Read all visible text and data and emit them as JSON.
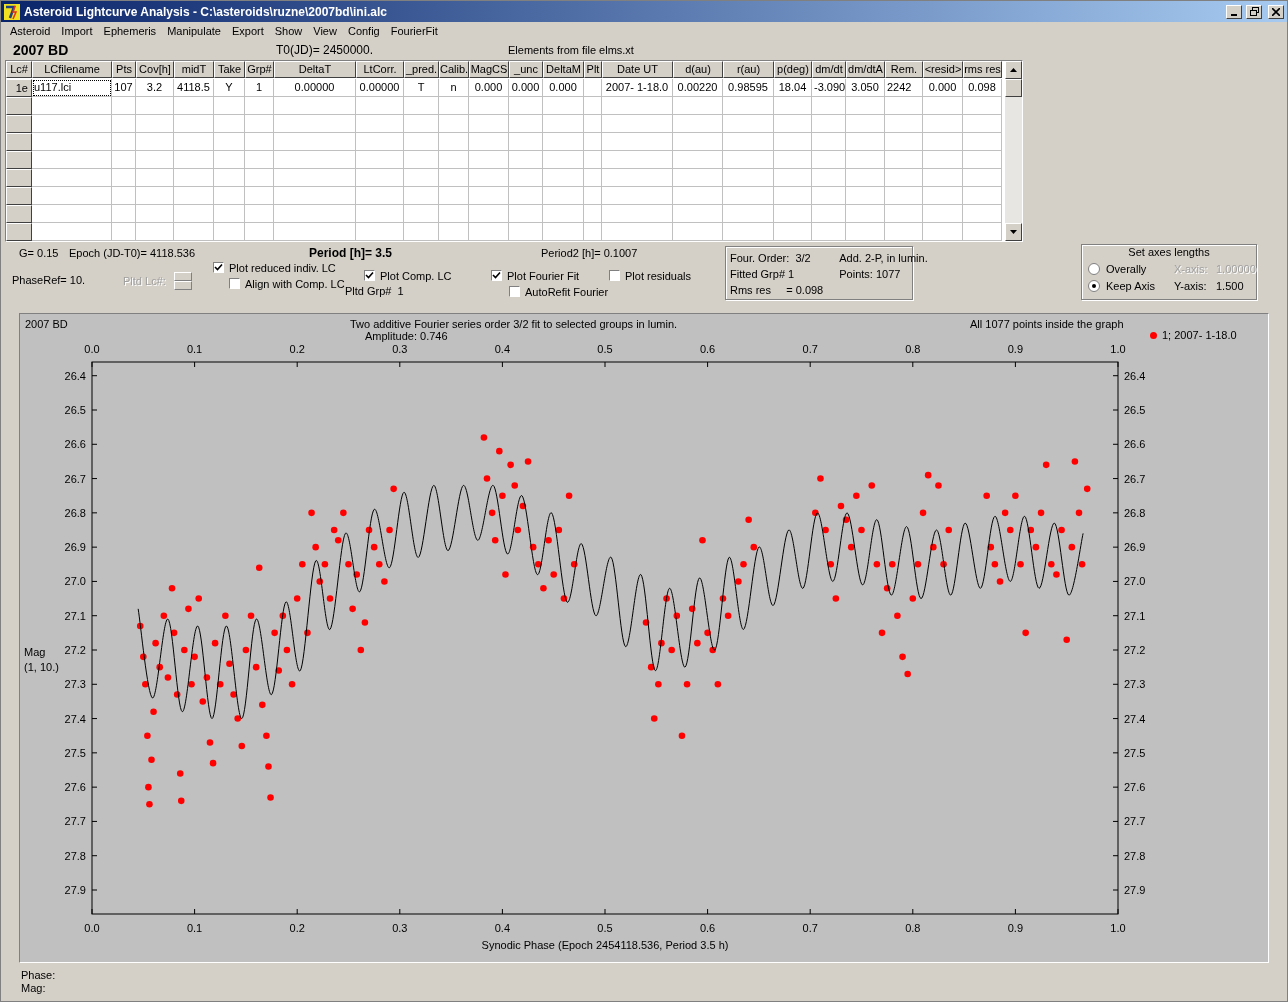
{
  "window": {
    "title": "Asteroid Lightcurve Analysis - C:\\asteroids\\ruzne\\2007bd\\ini.alc"
  },
  "menu": [
    "Asteroid",
    "Import",
    "Ephemeris",
    "Manipulate",
    "Export",
    "Show",
    "View",
    "Config",
    "FourierFit"
  ],
  "header": {
    "object": "2007 BD",
    "t0": "T0(JD)= 2450000.",
    "elements": "Elements from file elms.xt"
  },
  "table": {
    "columns": [
      "Lc#",
      "LCfilename",
      "Pts",
      "Cov[h]",
      "midT",
      "Take",
      "Grp#",
      "DeltaT",
      "LtCorr.",
      "_pred.",
      "Calib.",
      "MagCS",
      "_unc",
      "DeltaM",
      "Plt",
      "Date UT",
      "d(au)",
      "r(au)",
      "p(deg)",
      "dm/dt",
      "dm/dtA",
      "Rem.",
      "<resid>",
      "rms res"
    ],
    "rows": [
      {
        "cells": [
          "1e",
          "u117.lci",
          "107",
          "3.2",
          "4118.5",
          "Y",
          "1",
          "0.00000",
          "0.00000",
          "T",
          "n",
          "0.000",
          "0.000",
          "0.000",
          "",
          "2007- 1-18.0",
          "0.00220",
          "0.98595",
          "18.04",
          "-3.090",
          "3.050",
          "2242",
          "0.000",
          "0.098"
        ]
      }
    ]
  },
  "params": {
    "g": "G= 0.15",
    "epoch": "Epoch (JD-T0)= 4118.536",
    "period": "Period [h]= 3.5",
    "period2": "Period2 [h]= 0.1007",
    "phase_ref": "PhaseRef= 10.",
    "pltd_lc": {
      "label": "Pltd Lc#:",
      "disabled": true
    },
    "pltd_grp": "Pltd Grp#  1"
  },
  "checkboxes": [
    {
      "label": "Plot reduced indiv. LC",
      "checked": true
    },
    {
      "label": "Align with Comp. LC",
      "checked": false
    },
    {
      "label": "Plot Comp. LC",
      "checked": true
    },
    {
      "label": "Plot Fourier Fit",
      "checked": true
    },
    {
      "label": "Plot residuals",
      "checked": false
    },
    {
      "label": "AutoRefit Fourier",
      "checked": false
    }
  ],
  "fit_info": {
    "order": "Four. Order:  3/2",
    "mode": "Add. 2-P, in lumin.",
    "group": "Fitted Grp# 1",
    "points": "Points: 1077",
    "rms": "Rms res     = 0.098"
  },
  "axes": {
    "title": "Set axes lengths",
    "options": [
      {
        "label": "Overally",
        "selected": false
      },
      {
        "label": "Keep Axis",
        "selected": true
      }
    ],
    "x": {
      "label": "X-axis:",
      "value": "1.00000",
      "disabled": true
    },
    "y": {
      "label": "Y-axis:",
      "value": "1.500",
      "disabled": false
    }
  },
  "plot": {
    "object": "2007 BD",
    "amplitude": "Amplitude: 0.746",
    "points_note": "All 1077 points inside the graph",
    "ylabel_note": "(1, 10.)",
    "chart_data": {
      "type": "scatter",
      "title": "Two additive Fourier series order 3/2 fit to selected groups in lumin.",
      "xlabel": "Synodic Phase (Epoch 2454118.536, Period 3.5 h)",
      "ylabel": "Mag",
      "xlim": [
        0,
        1
      ],
      "ylim": [
        27.97,
        26.36
      ],
      "xticks": [
        {
          "value": 0,
          "label": "0.0"
        },
        {
          "value": 0.1,
          "label": "0.1"
        },
        {
          "value": 0.2,
          "label": "0.2"
        },
        {
          "value": 0.3,
          "label": "0.3"
        },
        {
          "value": 0.4,
          "label": "0.4"
        },
        {
          "value": 0.5,
          "label": "0.5"
        },
        {
          "value": 0.6,
          "label": "0.6"
        },
        {
          "value": 0.7,
          "label": "0.7"
        },
        {
          "value": 0.8,
          "label": "0.8"
        },
        {
          "value": 0.9,
          "label": "0.9"
        },
        {
          "value": 1,
          "label": "1.0"
        }
      ],
      "yticks": [
        {
          "value": 26.4,
          "label": "26.4"
        },
        {
          "value": 26.5,
          "label": "26.5"
        },
        {
          "value": 26.6,
          "label": "26.6"
        },
        {
          "value": 26.7,
          "label": "26.7"
        },
        {
          "value": 26.8,
          "label": "26.8"
        },
        {
          "value": 26.9,
          "label": "26.9"
        },
        {
          "value": 27,
          "label": "27.0"
        },
        {
          "value": 27.1,
          "label": "27.1"
        },
        {
          "value": 27.2,
          "label": "27.2"
        },
        {
          "value": 27.3,
          "label": "27.3"
        },
        {
          "value": 27.4,
          "label": "27.4"
        },
        {
          "value": 27.5,
          "label": "27.5"
        },
        {
          "value": 27.6,
          "label": "27.6"
        },
        {
          "value": 27.7,
          "label": "27.7"
        },
        {
          "value": 27.8,
          "label": "27.8"
        },
        {
          "value": 27.9,
          "label": "27.9"
        }
      ],
      "x": [
        0.045,
        0.047,
        0.05,
        0.052,
        0.054,
        0.055,
        0.056,
        0.058,
        0.059,
        0.06,
        0.062,
        0.066,
        0.07,
        0.074,
        0.078,
        0.08,
        0.083,
        0.086,
        0.087,
        0.088,
        0.09,
        0.094,
        0.097,
        0.1,
        0.103,
        0.104,
        0.108,
        0.112,
        0.115,
        0.117,
        0.118,
        0.12,
        0.125,
        0.13,
        0.131,
        0.134,
        0.138,
        0.142,
        0.146,
        0.15,
        0.155,
        0.16,
        0.163,
        0.166,
        0.17,
        0.172,
        0.174,
        0.175,
        0.178,
        0.182,
        0.186,
        0.189,
        0.19,
        0.195,
        0.2,
        0.203,
        0.205,
        0.21,
        0.214,
        0.218,
        0.222,
        0.227,
        0.232,
        0.236,
        0.24,
        0.245,
        0.247,
        0.25,
        0.254,
        0.258,
        0.261,
        0.262,
        0.266,
        0.27,
        0.275,
        0.28,
        0.285,
        0.29,
        0.294,
        0.304,
        0.318,
        0.333,
        0.347,
        0.362,
        0.376,
        0.382,
        0.385,
        0.39,
        0.391,
        0.393,
        0.397,
        0.4,
        0.403,
        0.405,
        0.408,
        0.412,
        0.415,
        0.419,
        0.42,
        0.425,
        0.43,
        0.434,
        0.435,
        0.44,
        0.445,
        0.448,
        0.45,
        0.455,
        0.46,
        0.463,
        0.465,
        0.47,
        0.477,
        0.491,
        0.506,
        0.52,
        0.535,
        0.54,
        0.545,
        0.548,
        0.549,
        0.552,
        0.555,
        0.56,
        0.563,
        0.565,
        0.57,
        0.575,
        0.578,
        0.58,
        0.585,
        0.59,
        0.592,
        0.595,
        0.6,
        0.605,
        0.607,
        0.61,
        0.615,
        0.62,
        0.621,
        0.63,
        0.635,
        0.64,
        0.645,
        0.65,
        0.664,
        0.679,
        0.693,
        0.705,
        0.707,
        0.71,
        0.715,
        0.72,
        0.722,
        0.725,
        0.73,
        0.735,
        0.736,
        0.74,
        0.745,
        0.75,
        0.751,
        0.76,
        0.765,
        0.77,
        0.775,
        0.779,
        0.78,
        0.785,
        0.79,
        0.794,
        0.795,
        0.8,
        0.805,
        0.808,
        0.81,
        0.815,
        0.82,
        0.823,
        0.825,
        0.83,
        0.835,
        0.837,
        0.851,
        0.866,
        0.872,
        0.876,
        0.88,
        0.885,
        0.89,
        0.895,
        0.9,
        0.905,
        0.909,
        0.91,
        0.915,
        0.92,
        0.923,
        0.925,
        0.93,
        0.935,
        0.938,
        0.94,
        0.945,
        0.95,
        0.952,
        0.955,
        0.958,
        0.962,
        0.965,
        0.966,
        0.97
      ],
      "series": [
        {
          "name": "1; 2007- 1-18.0",
          "type": "scatter",
          "color": "#ff0000",
          "values": [
            null,
            27.13,
            27.22,
            27.3,
            27.45,
            27.6,
            27.65,
            27.52,
            null,
            27.38,
            27.18,
            27.25,
            27.1,
            27.28,
            27.02,
            27.15,
            27.33,
            27.56,
            27.64,
            null,
            27.2,
            27.08,
            27.3,
            27.22,
            null,
            27.05,
            27.35,
            27.28,
            27.47,
            null,
            27.53,
            27.18,
            27.3,
            27.1,
            null,
            27.24,
            27.33,
            27.4,
            27.48,
            27.2,
            27.1,
            27.25,
            26.96,
            27.36,
            27.45,
            27.54,
            27.63,
            null,
            27.15,
            27.26,
            27.1,
            null,
            27.2,
            27.3,
            27.05,
            null,
            26.95,
            27.15,
            26.8,
            26.9,
            27.0,
            26.95,
            27.05,
            26.85,
            26.88,
            26.8,
            null,
            26.95,
            27.08,
            26.98,
            null,
            27.2,
            27.12,
            26.85,
            26.9,
            26.95,
            27.0,
            26.85,
            26.73,
            null,
            null,
            null,
            null,
            null,
            null,
            26.58,
            26.7,
            26.8,
            null,
            26.88,
            26.62,
            26.75,
            26.98,
            null,
            26.66,
            26.72,
            26.85,
            null,
            26.78,
            26.65,
            26.9,
            null,
            26.95,
            27.02,
            26.88,
            null,
            26.98,
            26.85,
            27.05,
            null,
            26.75,
            26.95,
            null,
            null,
            null,
            null,
            null,
            27.12,
            27.25,
            27.4,
            null,
            27.3,
            27.18,
            27.05,
            null,
            27.2,
            27.1,
            27.45,
            null,
            27.3,
            27.08,
            27.18,
            null,
            26.88,
            27.15,
            27.2,
            null,
            27.3,
            27.05,
            27.1,
            null,
            27.0,
            26.95,
            26.82,
            26.9,
            null,
            null,
            null,
            null,
            26.8,
            null,
            26.7,
            26.85,
            26.95,
            null,
            27.05,
            26.78,
            26.82,
            null,
            26.9,
            26.75,
            26.85,
            null,
            26.72,
            26.95,
            27.15,
            27.02,
            null,
            26.95,
            27.1,
            27.22,
            null,
            27.27,
            27.05,
            26.95,
            null,
            26.8,
            26.69,
            26.9,
            null,
            26.72,
            26.95,
            26.85,
            null,
            null,
            null,
            26.75,
            26.9,
            26.95,
            27.0,
            26.8,
            26.85,
            26.75,
            26.95,
            null,
            27.15,
            26.85,
            26.9,
            null,
            26.8,
            26.66,
            26.95,
            null,
            26.98,
            26.85,
            27.17,
            null,
            26.9,
            26.65,
            26.8,
            26.95,
            null,
            26.73
          ]
        },
        {
          "type": "line",
          "color": "#000000",
          "values": [
            27.08,
            null,
            null,
            null,
            null,
            null,
            null,
            null,
            27.34,
            null,
            null,
            null,
            null,
            27.11,
            null,
            null,
            null,
            null,
            null,
            27.38,
            null,
            null,
            null,
            null,
            27.13,
            null,
            null,
            null,
            null,
            27.4,
            null,
            null,
            null,
            null,
            27.13,
            null,
            null,
            null,
            27.4,
            null,
            null,
            27.11,
            null,
            null,
            null,
            null,
            null,
            27.33,
            null,
            null,
            null,
            27.06,
            null,
            null,
            null,
            27.26,
            null,
            null,
            null,
            26.94,
            null,
            null,
            27.14,
            null,
            null,
            null,
            26.86,
            null,
            null,
            null,
            27.03,
            null,
            null,
            null,
            26.79,
            null,
            null,
            26.96,
            null,
            26.74,
            26.93,
            26.72,
            26.91,
            26.72,
            26.88,
            null,
            null,
            null,
            26.72,
            null,
            null,
            null,
            null,
            26.92,
            null,
            null,
            null,
            26.75,
            null,
            null,
            null,
            26.98,
            null,
            null,
            null,
            26.8,
            null,
            null,
            null,
            27.06,
            null,
            null,
            26.89,
            27.1,
            26.93,
            27.19,
            26.98,
            null,
            null,
            null,
            27.26,
            null,
            null,
            null,
            27.02,
            null,
            null,
            null,
            27.25,
            null,
            null,
            null,
            26.99,
            null,
            null,
            null,
            27.2,
            null,
            null,
            null,
            26.93,
            null,
            27.14,
            null,
            null,
            26.9,
            27.07,
            26.85,
            27.02,
            null,
            26.8,
            null,
            null,
            null,
            27.0,
            null,
            null,
            null,
            26.8,
            null,
            null,
            null,
            27.01,
            null,
            26.82,
            null,
            null,
            27.04,
            null,
            null,
            null,
            26.84,
            null,
            null,
            null,
            27.05,
            null,
            null,
            null,
            26.85,
            null,
            null,
            null,
            27.04,
            26.83,
            27.02,
            null,
            null,
            26.81,
            null,
            null,
            27.0,
            null,
            null,
            26.81,
            null,
            null,
            null,
            27.02,
            null,
            null,
            null,
            26.83,
            null,
            null,
            null,
            27.04,
            null,
            null,
            null,
            null,
            26.86,
            null
          ]
        }
      ]
    }
  },
  "status": {
    "phase": "Phase:",
    "mag": "Mag:"
  }
}
